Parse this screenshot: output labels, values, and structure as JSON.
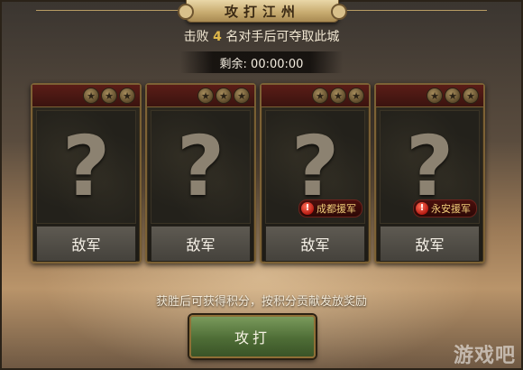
{
  "header": {
    "title": "攻打江州",
    "goal_prefix": "击败",
    "goal_count": "4",
    "goal_suffix": "名对手后可夺取此城",
    "timer": "剩余: 00:00:00"
  },
  "cards": [
    {
      "name": "敌军",
      "badge": ""
    },
    {
      "name": "敌军",
      "badge": ""
    },
    {
      "name": "敌军",
      "badge": "成都援军"
    },
    {
      "name": "敌军",
      "badge": "永安援军"
    }
  ],
  "card_placeholder": "?",
  "star_glyph": "★",
  "badge_icon_glyph": "!",
  "info": "获胜后可获得积分，按积分贡献发放奖励",
  "attack_button": "攻打",
  "watermark": "游戏吧"
}
